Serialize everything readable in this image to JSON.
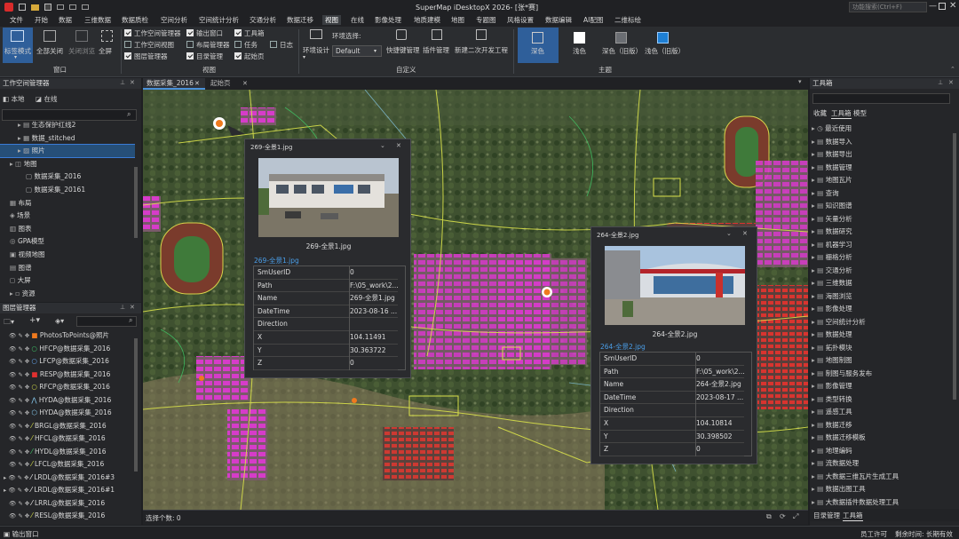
{
  "app": {
    "title": "SuperMap iDesktopX 2026- [张*赛]",
    "search_placeholder": "功能搜索(Ctrl+F)"
  },
  "menu": [
    "文件",
    "开始",
    "数据",
    "三维数据",
    "数据质检",
    "空间分析",
    "空间统计分析",
    "交通分析",
    "数据迁移",
    "视图",
    "在线",
    "影像处理",
    "地质建模",
    "地图",
    "专题图",
    "风格设置",
    "数据编辑",
    "AI配图",
    "二维标绘"
  ],
  "ribbon": {
    "window_buttons": [
      "标签模式",
      "全部关闭",
      "关闭浏览",
      "全屏"
    ],
    "window_group": "窗口",
    "view_checks": [
      {
        "label": "工作空间管理器",
        "checked": true
      },
      {
        "label": "输出窗口",
        "checked": true
      },
      {
        "label": "工具箱",
        "checked": true
      },
      {
        "label": "工作空间视图",
        "checked": false
      },
      {
        "label": "布局管理器",
        "checked": false
      },
      {
        "label": "任务",
        "checked": false
      },
      {
        "label": "日志",
        "checked": false
      },
      {
        "label": "图层管理器",
        "checked": true
      },
      {
        "label": "目录管理",
        "checked": true
      },
      {
        "label": "起始页",
        "checked": true
      }
    ],
    "view_group": "视图",
    "env_label": "环境设计",
    "env_select_label": "环境选择:",
    "env_value": "Default",
    "custom_buttons": [
      "快捷键管理",
      "插件管理",
      "新建二次开发工程"
    ],
    "custom_group": "自定义",
    "themes": [
      {
        "label": "深色",
        "color": "#3b3f46"
      },
      {
        "label": "浅色",
        "color": "#ffffff"
      },
      {
        "label": "深色（旧版）",
        "color": "#6b6e73"
      },
      {
        "label": "浅色（旧版）",
        "color": "#1e7fd4"
      }
    ],
    "theme_group": "主题"
  },
  "workspace": {
    "title": "工作空间管理器",
    "tabs": [
      "本地",
      "在线"
    ],
    "items": [
      {
        "label": "生态保护红线2",
        "indent": 2
      },
      {
        "label": "数据_stitched",
        "indent": 2
      },
      {
        "label": "照片",
        "indent": 2,
        "selected": true
      },
      {
        "label": "地图",
        "indent": 1
      },
      {
        "label": "数据采集_2016",
        "indent": 3
      },
      {
        "label": "数据采集_20161",
        "indent": 3
      },
      {
        "label": "布局",
        "indent": 1
      },
      {
        "label": "场景",
        "indent": 1
      },
      {
        "label": "图表",
        "indent": 1
      },
      {
        "label": "GPA模型",
        "indent": 1
      },
      {
        "label": "视频地图",
        "indent": 1
      },
      {
        "label": "图谱",
        "indent": 1
      },
      {
        "label": "大屏",
        "indent": 1
      },
      {
        "label": "资源",
        "indent": 1
      }
    ]
  },
  "layers": {
    "title": "图层管理器",
    "items": [
      "PhotosToPoints@照片",
      "HFCP@数据采集_2016",
      "LFCP@数据采集_2016",
      "RESP@数据采集_2016",
      "RFCP@数据采集_2016",
      "HYDA@数据采集_2016",
      "HYDA@数据采集_2016",
      "BRGL@数据采集_2016",
      "HFCL@数据采集_2016",
      "HYDL@数据采集_2016",
      "LFCL@数据采集_2016",
      "LRDL@数据采集_2016#3",
      "LRDL@数据采集_2016#1",
      "LRRL@数据采集_2016",
      "RESL@数据采集_2016"
    ]
  },
  "doc_tabs": [
    "数据采集_2016",
    "起始页"
  ],
  "popup1": {
    "title": "269-全景1.jpg",
    "caption": "269-全景1.jpg",
    "tab": "269-全景1.jpg",
    "rows": [
      [
        "SmUserID",
        "0"
      ],
      [
        "Path",
        "F:\\05_work\\2..."
      ],
      [
        "Name",
        "269-全景1.jpg"
      ],
      [
        "DateTime",
        "2023-08-16 ..."
      ],
      [
        "Direction",
        ""
      ],
      [
        "X",
        "104.11491"
      ],
      [
        "Y",
        "30.363722"
      ],
      [
        "Z",
        "0"
      ]
    ]
  },
  "popup2": {
    "title": "264-全景2.jpg",
    "caption": "264-全景2.jpg",
    "tab": "264-全景2.jpg",
    "rows": [
      [
        "SmUserID",
        "0"
      ],
      [
        "Path",
        "F:\\05_work\\2..."
      ],
      [
        "Name",
        "264-全景2.jpg"
      ],
      [
        "DateTime",
        "2023-08-17 ..."
      ],
      [
        "Direction",
        ""
      ],
      [
        "X",
        "104.10814"
      ],
      [
        "Y",
        "30.398502"
      ],
      [
        "Z",
        "0"
      ]
    ]
  },
  "map_status": "选择个数: 0",
  "toolbox": {
    "title": "工具箱",
    "tabs": [
      "收藏",
      "工具箱",
      "模型"
    ],
    "items": [
      "最近使用",
      "数据导入",
      "数据导出",
      "数据管理",
      "地图瓦片",
      "查询",
      "知识图谱",
      "矢量分析",
      "数据研究",
      "机器学习",
      "栅格分析",
      "交通分析",
      "三维数据",
      "海图浏览",
      "影像处理",
      "空间统计分析",
      "数据处理",
      "拓扑模块",
      "地图制图",
      "制图与服务发布",
      "影像管理",
      "类型转换",
      "遥感工具",
      "数据迁移",
      "数据迁移模板",
      "地理编码",
      "流数据处理",
      "大数据三维瓦片生成工具",
      "数据出图工具",
      "大数据插件数据处理工具"
    ],
    "bottom_tabs": [
      "目录管理",
      "工具箱"
    ]
  },
  "status": {
    "output": "输出窗口",
    "license": "员工许可",
    "time": "剩余时间: 长期有效"
  }
}
